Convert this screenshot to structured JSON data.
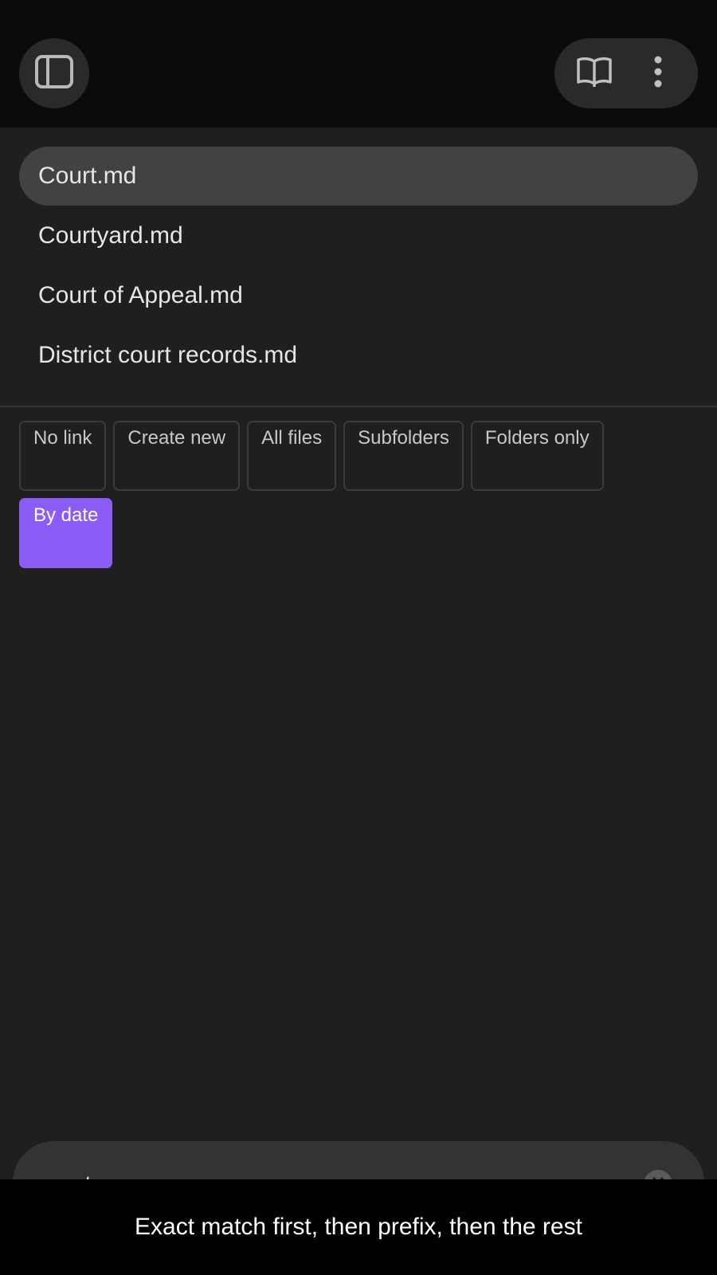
{
  "header": {
    "sidebar_toggle_icon": "sidebar-toggle-icon",
    "reading_view_icon": "book-open-icon",
    "more_menu_icon": "more-vertical-icon"
  },
  "suggestions": [
    {
      "label": "Court.md",
      "active": true
    },
    {
      "label": "Courtyard.md",
      "active": false
    },
    {
      "label": "Court of Appeal.md",
      "active": false
    },
    {
      "label": "District court records.md",
      "active": false
    }
  ],
  "filters": [
    {
      "label": "No link",
      "selected": false
    },
    {
      "label": "Create new",
      "selected": false
    },
    {
      "label": "All files",
      "selected": false
    },
    {
      "label": "Subfolders",
      "selected": false
    },
    {
      "label": "Folders only",
      "selected": false
    },
    {
      "label": "By date",
      "selected": true
    }
  ],
  "search": {
    "value": "court",
    "clear_icon": "clear-icon"
  },
  "caption": "Exact match first, then prefix, then the rest",
  "colors": {
    "accent": "#8b5cf6",
    "topbar": "#0b0b0b",
    "sheet": "#1f1f1f",
    "active_row": "#424242"
  }
}
